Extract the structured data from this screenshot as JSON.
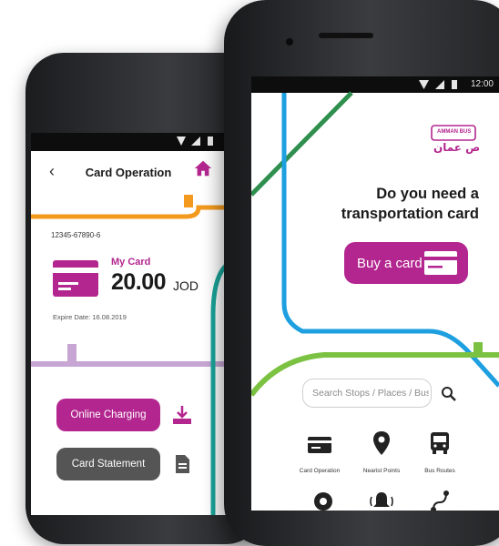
{
  "back_screen": {
    "title": "Card Operation",
    "card_number": "12345-67890-6",
    "my_card_label": "My Card",
    "balance": "20.00",
    "currency": "JOD",
    "expire": "Expire Date:  16.08.2019",
    "buttons": {
      "online_charging": "Online Charging",
      "card_statement": "Card Statement"
    }
  },
  "front_screen": {
    "time": "12:00",
    "logo_text_en": "AMMAN BUS",
    "logo_text_ar": "باص عمان",
    "headline_line1": "Do you need a",
    "headline_line2": "transportation card",
    "buy_button": "Buy a card",
    "search": {
      "placeholder": "Search Stops / Places / Buses"
    },
    "grid": [
      {
        "label": "Card Operation",
        "icon": "card-icon"
      },
      {
        "label": "Nearist Points",
        "icon": "map-pin-icon"
      },
      {
        "label": "Bus Routes",
        "icon": "bus-icon"
      }
    ]
  },
  "colors": {
    "accent": "#b3268f",
    "line_orange": "#f39a1e",
    "line_lilac": "#c7a6d3",
    "line_teal": "#1aa59a",
    "line_blue": "#1e9fe0",
    "line_green": "#7cc242",
    "line_dark_green": "#2f8f4e"
  }
}
